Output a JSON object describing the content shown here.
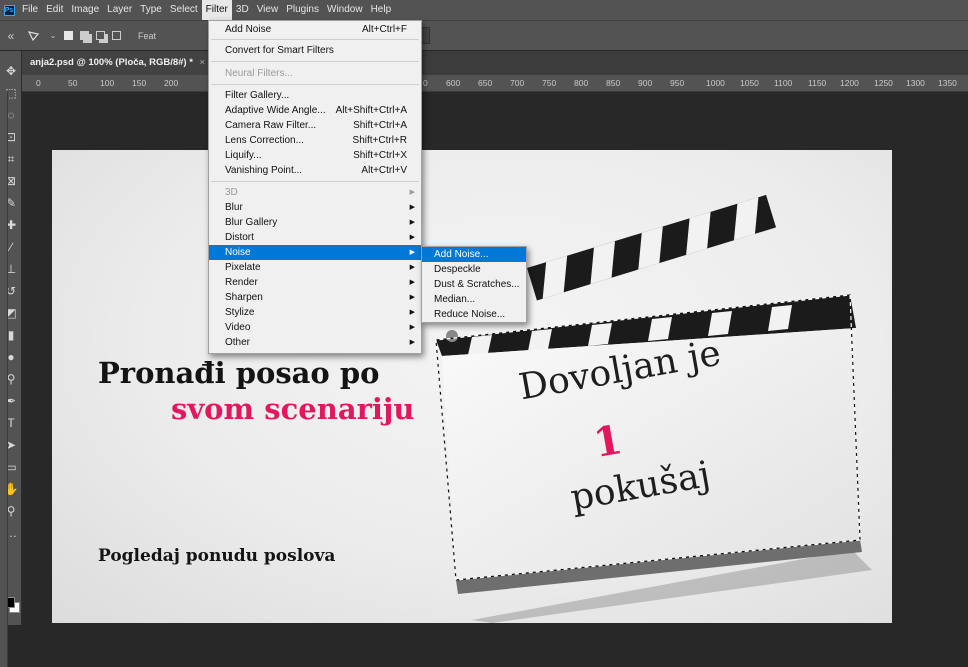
{
  "menubar": {
    "app_logo": "Ps",
    "items": [
      "File",
      "Edit",
      "Image",
      "Layer",
      "Type",
      "Select",
      "Filter",
      "3D",
      "View",
      "Plugins",
      "Window",
      "Help"
    ]
  },
  "options": {
    "feather_label": "Feat"
  },
  "document": {
    "tab_title": "anja2.psd @ 100% (Ploča, RGB/8#) *",
    "close": "×"
  },
  "ruler": {
    "left_ticks": [
      "0",
      "50",
      "100",
      "150",
      "200"
    ],
    "right_ticks": [
      "600",
      "650",
      "700",
      "750",
      "800",
      "850",
      "900",
      "950",
      "1000",
      "1050",
      "1100",
      "1150",
      "1200",
      "1250",
      "1300",
      "1350"
    ],
    "mid_tick": "0"
  },
  "filter_menu": {
    "items": [
      {
        "label": "Add Noise",
        "shortcut": "Alt+Ctrl+F"
      },
      {
        "label": "Convert for Smart Filters",
        "shortcut": ""
      },
      {
        "label": "Neural Filters...",
        "shortcut": ""
      },
      {
        "label": "Filter Gallery...",
        "shortcut": ""
      },
      {
        "label": "Adaptive Wide Angle...",
        "shortcut": "Alt+Shift+Ctrl+A"
      },
      {
        "label": "Camera Raw Filter...",
        "shortcut": "Shift+Ctrl+A"
      },
      {
        "label": "Lens Correction...",
        "shortcut": "Shift+Ctrl+R"
      },
      {
        "label": "Liquify...",
        "shortcut": "Shift+Ctrl+X"
      },
      {
        "label": "Vanishing Point...",
        "shortcut": "Alt+Ctrl+V"
      },
      {
        "label": "3D"
      },
      {
        "label": "Blur"
      },
      {
        "label": "Blur Gallery"
      },
      {
        "label": "Distort"
      },
      {
        "label": "Noise"
      },
      {
        "label": "Pixelate"
      },
      {
        "label": "Render"
      },
      {
        "label": "Sharpen"
      },
      {
        "label": "Stylize"
      },
      {
        "label": "Video"
      },
      {
        "label": "Other"
      }
    ]
  },
  "noise_submenu": {
    "items": [
      "Add Noise...",
      "Despeckle",
      "Dust & Scratches...",
      "Median...",
      "Reduce Noise..."
    ]
  },
  "artwork": {
    "headline_1": "Pronađi posao po",
    "headline_2": "svom scenariju",
    "cta": "Pogledaj ponudu poslova",
    "board_line_1": "Dovoljan je",
    "board_line_2": "1",
    "board_line_3": "pokušaj",
    "accent_color": "#e3175e"
  }
}
